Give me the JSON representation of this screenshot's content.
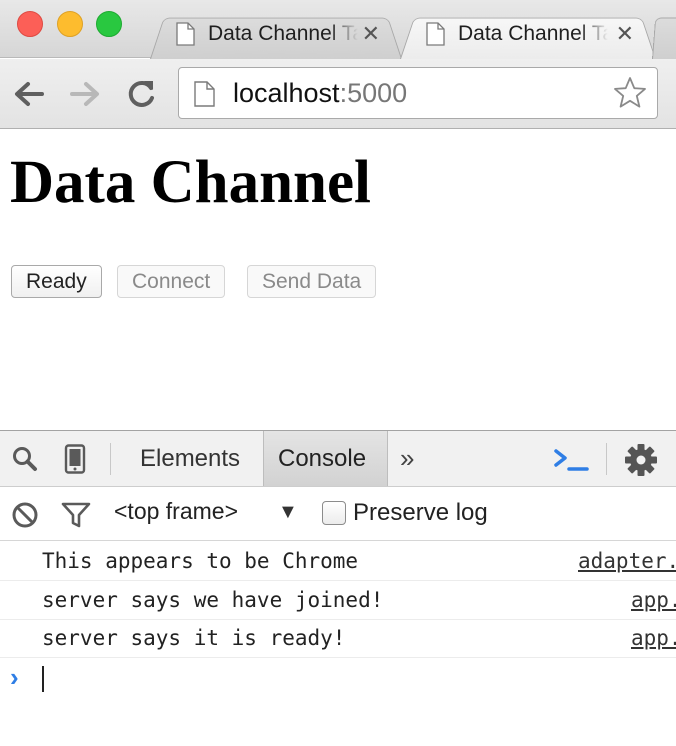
{
  "browser": {
    "tabs": [
      {
        "label": "Data Channel Tab",
        "active": false
      },
      {
        "label": "Data Channel Tab",
        "active": true
      }
    ],
    "close_glyph": "✕",
    "address": {
      "host": "localhost",
      "port": ":5000"
    }
  },
  "page": {
    "title": "Data Channel",
    "buttons": {
      "ready": "Ready",
      "connect": "Connect",
      "send": "Send Data"
    }
  },
  "devtools": {
    "tabs": {
      "elements": "Elements",
      "console": "Console",
      "more": "»"
    },
    "frame_select": "<top frame>",
    "frame_arrow": "▼",
    "preserve_log": "Preserve log",
    "logs": [
      {
        "message": "This appears to be Chrome",
        "source": "adapter."
      },
      {
        "message": "server says we have joined!",
        "source": "app."
      },
      {
        "message": "server says it is ready!",
        "source": "app."
      }
    ],
    "prompt_glyph": "›",
    "accent_color": "#2f7ee5"
  },
  "icons": [
    "page-icon",
    "back-arrow-icon",
    "forward-arrow-icon",
    "reload-icon",
    "star-icon",
    "search-icon",
    "device-mode-icon",
    "console-drawer-icon",
    "gear-icon",
    "clear-icon",
    "filter-icon"
  ]
}
